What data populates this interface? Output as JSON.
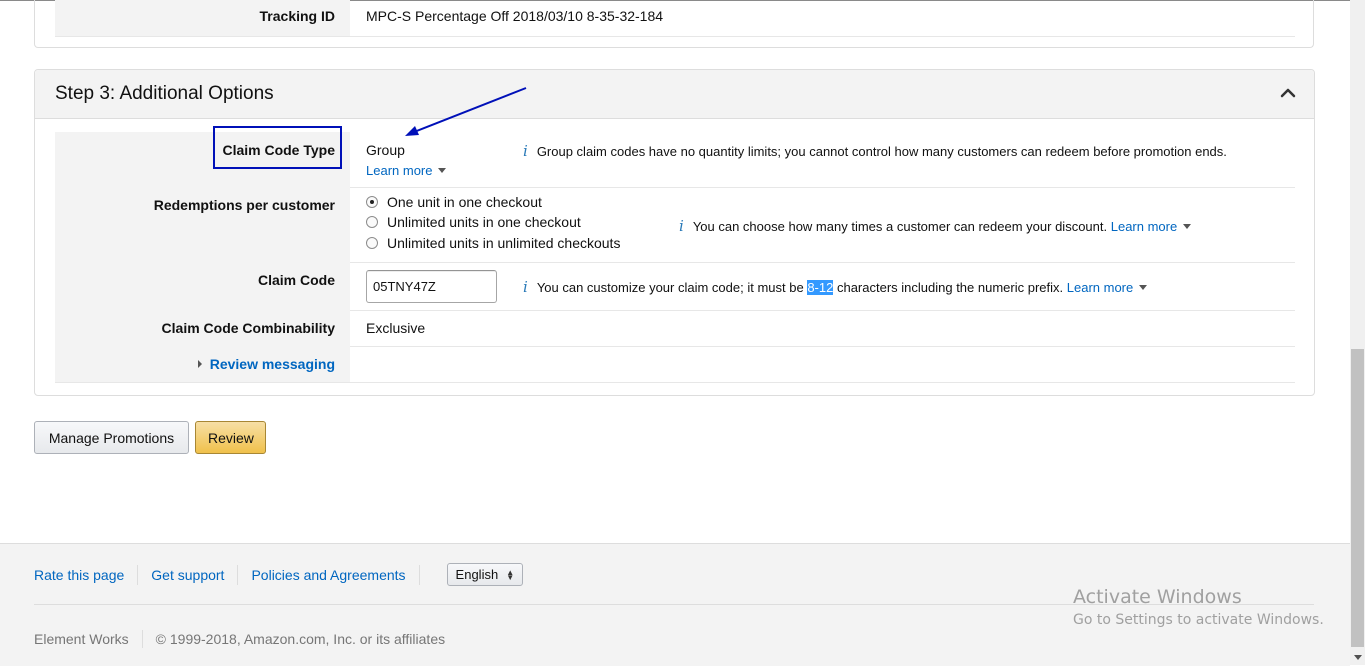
{
  "tracking": {
    "label": "Tracking ID",
    "value": "MPC-S Percentage Off 2018/03/10 8-35-32-184"
  },
  "step3": {
    "title": "Step 3: Additional Options",
    "collapse_icon": "chevron-up-icon",
    "claim_code_type": {
      "label": "Claim Code Type",
      "value": "Group",
      "learn_more": "Learn more",
      "info": "Group claim codes have no quantity limits; you cannot control how many customers can redeem before promotion ends."
    },
    "redemptions": {
      "label": "Redemptions per customer",
      "options": [
        {
          "label": "One unit in one checkout",
          "checked": true
        },
        {
          "label": "Unlimited units in one checkout",
          "checked": false
        },
        {
          "label": "Unlimited units in unlimited checkouts",
          "checked": false
        }
      ],
      "info": "You can choose how many times a customer can redeem your discount.",
      "learn_more": "Learn more"
    },
    "claim_code": {
      "label": "Claim Code",
      "value": "05TNY47Z",
      "info_before": "You can customize your claim code; it must be",
      "info_highlight": "8-12",
      "info_after": "characters including the numeric prefix.",
      "learn_more": "Learn more"
    },
    "combinability": {
      "label": "Claim Code Combinability",
      "value": "Exclusive"
    },
    "review_messaging": {
      "label": "Review messaging"
    }
  },
  "buttons": {
    "manage": "Manage Promotions",
    "review": "Review"
  },
  "footer": {
    "links": [
      "Rate this page",
      "Get support",
      "Policies and Agreements"
    ],
    "language": "English",
    "brand": "Element Works",
    "copyright": "© 1999-2018, Amazon.com, Inc. or its affiliates"
  },
  "watermark": {
    "title": "Activate Windows",
    "subtitle": "Go to Settings to activate Windows."
  },
  "colors": {
    "link": "#0066c0",
    "annotation": "#0010b8",
    "review_button": "#f0c14b",
    "info_icon": "#2a7ab8",
    "selection_highlight": "#3399ff"
  }
}
